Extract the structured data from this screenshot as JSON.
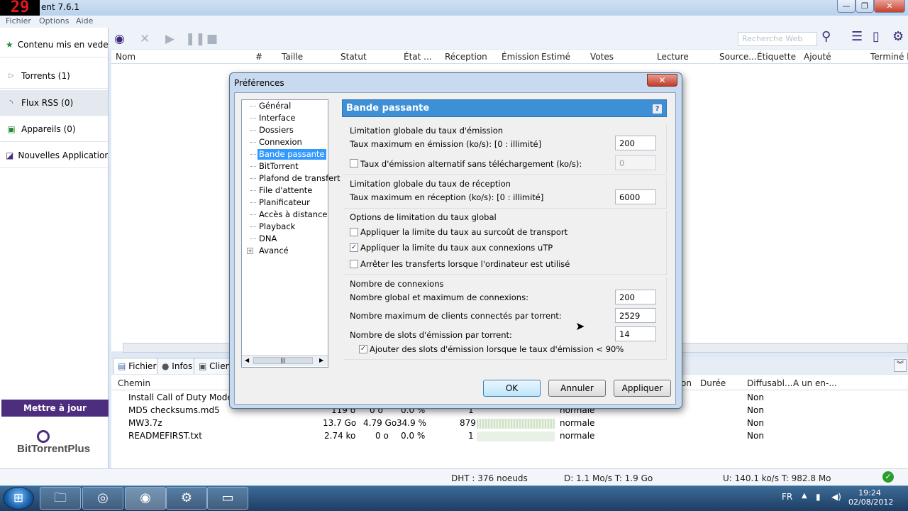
{
  "app": {
    "fps_counter": "29",
    "title": "ent 7.6.1",
    "window_buttons": {
      "minimize": "—",
      "maximize": "❐",
      "close": "✕"
    }
  },
  "menu": [
    "Fichier",
    "Options",
    "Aide"
  ],
  "sidebar": {
    "items": [
      {
        "label": "Contenu mis en vedette",
        "icon": "star-icon"
      },
      {
        "label": "Torrents (1)",
        "icon": "expand-arrow-icon"
      },
      {
        "label": "Flux RSS (0)",
        "icon": "rss-icon"
      },
      {
        "label": "Appareils (0)",
        "icon": "device-icon"
      },
      {
        "label": "Nouvelles Applications",
        "icon": "apps-icon"
      }
    ],
    "update_button": "Mettre à jour",
    "logo_text": "BitTorrentPlus"
  },
  "toolbar": {
    "search_placeholder": "Recherche Web"
  },
  "list_columns": [
    "Nom",
    "#",
    "Taille",
    "Statut",
    "État ...",
    "Réception",
    "Émission",
    "Estimé",
    "Votes",
    "Lecture",
    "Source...",
    "Étiquette",
    "Ajouté",
    "Terminé le"
  ],
  "bottom_tabs": [
    "Fichiers",
    "Infos",
    "Client"
  ],
  "detail_columns": {
    "path": "Chemin",
    "on": "on",
    "duration": "Durée",
    "streamable": "Diffusabl...",
    "header": "A un en-..."
  },
  "files": [
    {
      "name": "Install Call of Duty Modern W",
      "size": "",
      "done": "",
      "pct": "",
      "pieces": "",
      "priority": "",
      "streamable": "Non"
    },
    {
      "name": "MD5 checksums.md5",
      "size": "119 o",
      "done": "0 o",
      "pct": "0.0 %",
      "pieces": "1",
      "priority": "normale",
      "streamable": "Non"
    },
    {
      "name": "MW3.7z",
      "size": "13.7 Go",
      "done": "4.79 Go",
      "pct": "34.9 %",
      "pieces": "879",
      "priority": "normale",
      "streamable": "Non"
    },
    {
      "name": "READMEFIRST.txt",
      "size": "2.74 ko",
      "done": "0 o",
      "pct": "0.0 %",
      "pieces": "1",
      "priority": "normale",
      "streamable": "Non"
    }
  ],
  "status": {
    "dht": "DHT : 376 noeuds",
    "download": "D: 1.1 Mo/s T: 1.9 Go",
    "upload": "U: 140.1 ko/s T: 982.8 Mo"
  },
  "taskbar": {
    "lang": "FR",
    "time": "19:24",
    "date": "02/08/2012",
    "start": "⊞"
  },
  "dialog": {
    "title": "Préférences",
    "close_label": "✕",
    "tree": [
      "Général",
      "Interface",
      "Dossiers",
      "Connexion",
      "Bande passante",
      "BitTorrent",
      "Plafond de transfert",
      "File d'attente",
      "Planificateur",
      "Accès à distance",
      "Playback",
      "DNA",
      "Avancé"
    ],
    "selected_index": 4,
    "panel_title": "Bande passante",
    "help": "?",
    "upload_group": {
      "title": "Limitation globale du taux d'émission",
      "max_label": "Taux maximum en émission (ko/s): [0 : illimité]",
      "max_value": "200",
      "alt_label": "Taux d'émission alternatif sans téléchargement (ko/s):",
      "alt_checked": false,
      "alt_value": "0"
    },
    "download_group": {
      "title": "Limitation globale du taux de réception",
      "max_label": "Taux maximum en réception (ko/s): [0 : illimité]",
      "max_value": "6000"
    },
    "options_group": {
      "title": "Options de limitation du taux global",
      "opt1": "Appliquer la limite du taux au surcoût de transport",
      "opt1_checked": false,
      "opt2": "Appliquer la limite du taux aux connexions uTP",
      "opt2_checked": true,
      "opt3": "Arrêter les transferts lorsque l'ordinateur est utilisé",
      "opt3_checked": false
    },
    "connections_group": {
      "title": "Nombre de connexions",
      "global_label": "Nombre global et maximum de connexions:",
      "global_value": "200",
      "peers_label": "Nombre maximum de clients connectés par torrent:",
      "peers_value": "2529",
      "slots_label": "Nombre de slots d'émission par torrent:",
      "slots_value": "14",
      "extra_label": "Ajouter des slots d'émission lorsque le taux d'émission < 90%",
      "extra_checked": true
    },
    "buttons": {
      "ok": "OK",
      "cancel": "Annuler",
      "apply": "Appliquer"
    }
  }
}
